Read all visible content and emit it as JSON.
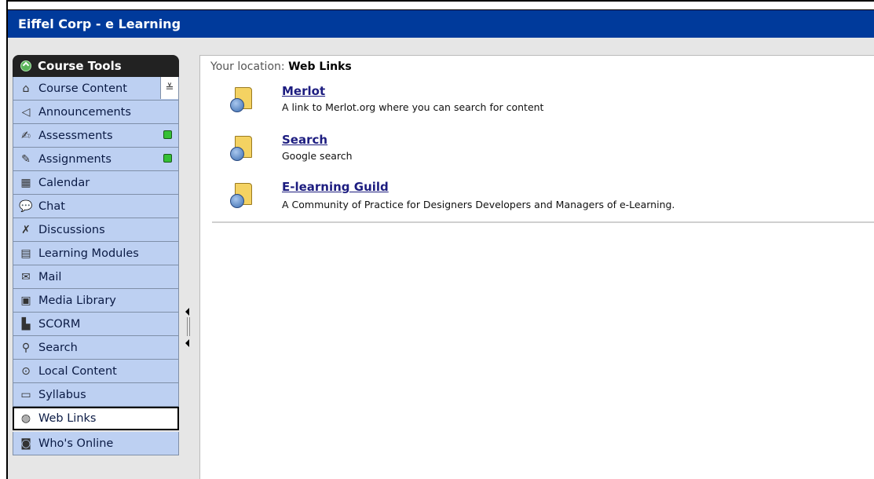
{
  "window": {
    "title": "Eiffel Corp - e Learning"
  },
  "sidebar": {
    "header": "Course Tools",
    "items": [
      {
        "label": "Course Content",
        "icon": "home-icon",
        "expand": true
      },
      {
        "label": "Announcements",
        "icon": "megaphone-icon"
      },
      {
        "label": "Assessments",
        "icon": "assessment-icon",
        "new": true
      },
      {
        "label": "Assignments",
        "icon": "assignment-icon",
        "new": true
      },
      {
        "label": "Calendar",
        "icon": "calendar-icon"
      },
      {
        "label": "Chat",
        "icon": "chat-icon"
      },
      {
        "label": "Discussions",
        "icon": "pushpin-icon"
      },
      {
        "label": "Learning Modules",
        "icon": "modules-icon"
      },
      {
        "label": "Mail",
        "icon": "mail-icon"
      },
      {
        "label": "Media Library",
        "icon": "media-icon"
      },
      {
        "label": "SCORM",
        "icon": "scorm-icon"
      },
      {
        "label": "Search",
        "icon": "magnifier-icon"
      },
      {
        "label": "Local Content",
        "icon": "local-content-icon"
      },
      {
        "label": "Syllabus",
        "icon": "syllabus-icon"
      },
      {
        "label": "Web Links",
        "icon": "weblinks-icon",
        "active": true
      },
      {
        "label": "Who's Online",
        "icon": "whos-online-icon"
      }
    ]
  },
  "content": {
    "location_label": "Your location:",
    "location_value": "Web Links",
    "links": [
      {
        "title": "Merlot",
        "description": "A link to Merlot.org where you can search for content"
      },
      {
        "title": "Search",
        "description": "Google search"
      },
      {
        "title": "E-learning Guild",
        "description": "A Community of Practice for Designers Developers and Managers of e-Learning."
      }
    ]
  },
  "colors": {
    "titlebar": "#003a9b",
    "sidebar_item": "#bdd0f2",
    "link": "#1d1d80",
    "new_badge": "#35c035"
  }
}
